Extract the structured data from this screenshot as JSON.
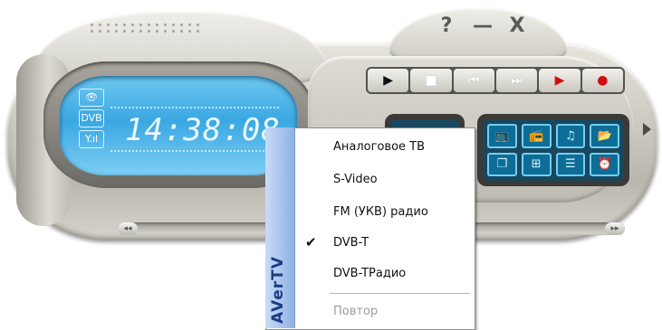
{
  "window": {
    "help_label": "?",
    "minimize_label": "—",
    "close_label": "X"
  },
  "display": {
    "time": "14:38:08",
    "indicators": [
      "👁",
      "DVB",
      "Y.ıl"
    ]
  },
  "transport": {
    "buttons": [
      {
        "icon": "play-icon",
        "glyph": "▶",
        "color": "#111111"
      },
      {
        "icon": "stop-icon",
        "glyph": "■",
        "color": "#ffffff"
      },
      {
        "icon": "previous-icon",
        "glyph": "⏮",
        "color": "#ffffff"
      },
      {
        "icon": "next-icon",
        "glyph": "⏭",
        "color": "#ffffff"
      },
      {
        "icon": "playback-icon",
        "glyph": "▶",
        "color": "#d01010"
      },
      {
        "icon": "record-icon",
        "glyph": "●",
        "color": "#d01010"
      }
    ]
  },
  "functions": {
    "buttons": [
      {
        "icon": "tv-icon",
        "glyph": "📺"
      },
      {
        "icon": "radio-icon",
        "glyph": "📻"
      },
      {
        "icon": "music-icon",
        "glyph": "♫"
      },
      {
        "icon": "folder-icon",
        "glyph": "📂"
      },
      {
        "icon": "window-icon",
        "glyph": "❐"
      },
      {
        "icon": "pip-icon",
        "glyph": "⊞"
      },
      {
        "icon": "list-icon",
        "glyph": "☰"
      },
      {
        "icon": "alarm-icon",
        "glyph": "⏰"
      }
    ]
  },
  "context_menu": {
    "brand": "AVerTV",
    "items": [
      {
        "label": "Аналоговое ТВ",
        "checked": false,
        "disabled": false
      },
      {
        "label": "S-Video",
        "checked": false,
        "disabled": false
      },
      {
        "label": "FM (УКВ) радио",
        "checked": false,
        "disabled": false
      },
      {
        "label": "DVB-T",
        "checked": true,
        "disabled": false
      },
      {
        "label": "DVB-TРадио",
        "checked": false,
        "disabled": false
      }
    ],
    "disabled_item": "Повтор",
    "check_glyph": "✔"
  },
  "colors": {
    "accent_display": "#3aa7e2",
    "record_red": "#d01010"
  }
}
